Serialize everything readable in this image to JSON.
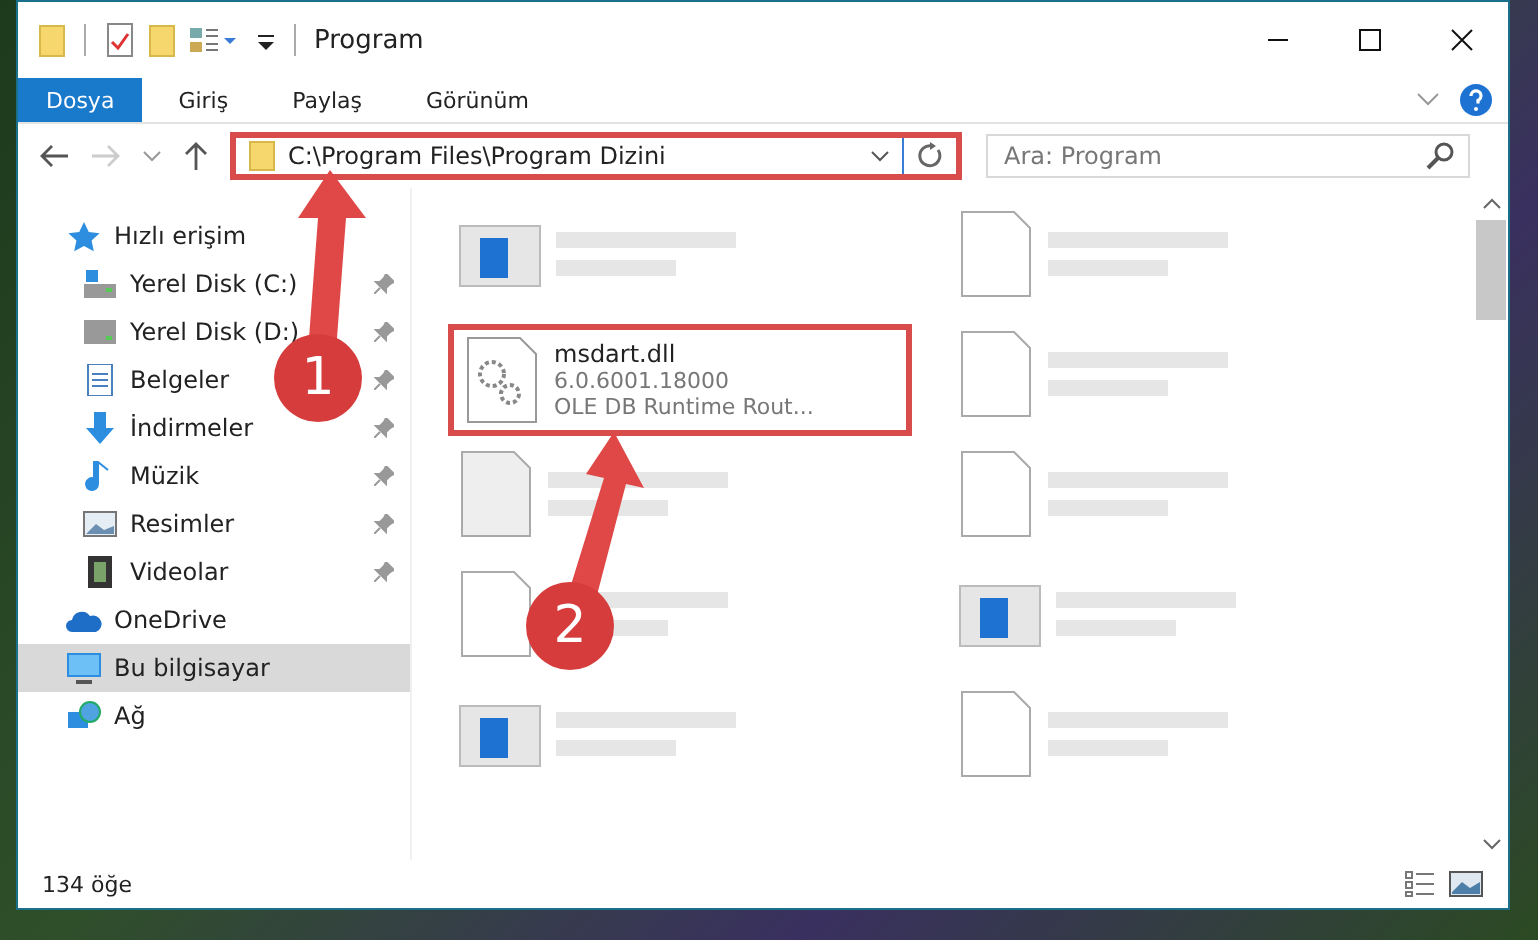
{
  "window": {
    "title": "Program"
  },
  "ribbon_tabs": [
    {
      "label": "Dosya",
      "selected": true
    },
    {
      "label": "Giriş",
      "selected": false
    },
    {
      "label": "Paylaş",
      "selected": false
    },
    {
      "label": "Görünüm",
      "selected": false
    }
  ],
  "address_bar": {
    "value": "C:\\Program Files\\Program Dizini",
    "highlighted": true
  },
  "search": {
    "placeholder": "Ara: Program"
  },
  "sidebar": {
    "items": [
      {
        "label": "Hızlı erişim",
        "kind": "star",
        "pinned": false,
        "selected": false,
        "children": [
          {
            "label": "Yerel Disk (C:)",
            "kind": "disk-c",
            "pinned": true,
            "selected": false
          },
          {
            "label": "Yerel Disk (D:)",
            "kind": "disk",
            "pinned": true,
            "selected": false
          },
          {
            "label": "Belgeler",
            "kind": "document",
            "pinned": true,
            "selected": false
          },
          {
            "label": "İndirmeler",
            "kind": "download",
            "pinned": true,
            "selected": false
          },
          {
            "label": "Müzik",
            "kind": "music",
            "pinned": true,
            "selected": false
          },
          {
            "label": "Resimler",
            "kind": "pictures",
            "pinned": true,
            "selected": false
          },
          {
            "label": "Videolar",
            "kind": "video",
            "pinned": true,
            "selected": false
          }
        ]
      },
      {
        "label": "OneDrive",
        "kind": "cloud",
        "pinned": false,
        "selected": false
      },
      {
        "label": "Bu bilgisayar",
        "kind": "computer",
        "pinned": false,
        "selected": true
      },
      {
        "label": "Ağ",
        "kind": "network",
        "pinned": false,
        "selected": false
      }
    ]
  },
  "files": [
    {
      "kind": "exe",
      "blurred": true,
      "highlighted": false
    },
    {
      "kind": "doc",
      "blurred": true,
      "highlighted": false
    },
    {
      "name": "msdart.dll",
      "lines": [
        "6.0.6001.18000",
        "OLE DB Runtime Rout..."
      ],
      "kind": "dll",
      "blurred": false,
      "highlighted": true
    },
    {
      "kind": "doc",
      "blurred": true,
      "highlighted": false
    },
    {
      "kind": "txt",
      "blurred": true,
      "highlighted": false
    },
    {
      "kind": "doc",
      "blurred": true,
      "highlighted": false
    },
    {
      "kind": "doc",
      "blurred": true,
      "highlighted": false
    },
    {
      "kind": "app",
      "blurred": true,
      "highlighted": false
    },
    {
      "kind": "app",
      "blurred": true,
      "highlighted": false
    },
    {
      "kind": "doc",
      "blurred": true,
      "highlighted": false
    }
  ],
  "annotations": [
    {
      "label": "1"
    },
    {
      "label": "2"
    }
  ],
  "status_bar": {
    "count": "134 öğe"
  }
}
